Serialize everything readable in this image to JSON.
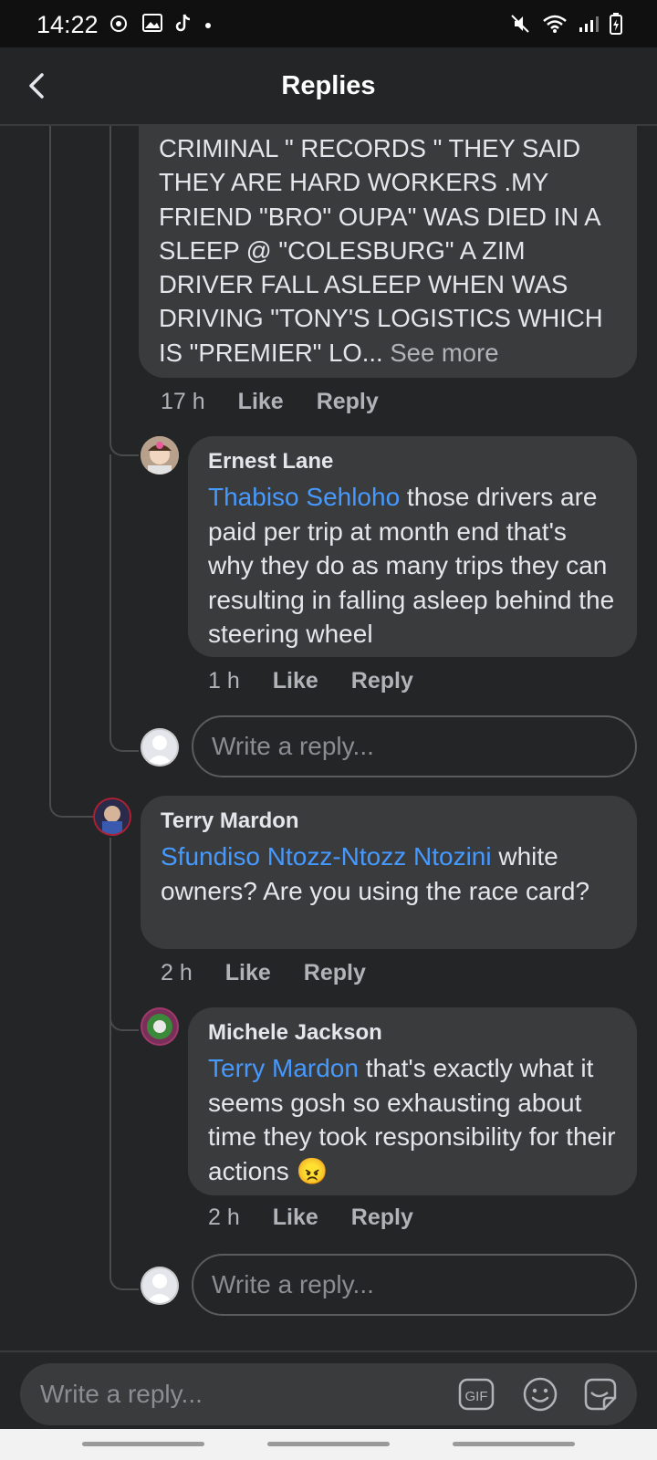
{
  "status_bar": {
    "time": "14:22"
  },
  "header": {
    "title": "Replies"
  },
  "comments": [
    {
      "partial_text": "CRIMINAL \" RECORDS \" THEY SAID THEY ARE HARD WORKERS .MY FRIEND \"BRO\" OUPA\" WAS DIED IN A SLEEP @ \"COLESBURG\" A ZIM DRIVER FALL ASLEEP WHEN WAS DRIVING \"TONY'S LOGISTICS WHICH IS \"PREMIER\" LO...",
      "see_more": "See more",
      "time": "17 h",
      "like": "Like",
      "reply": "Reply"
    },
    {
      "author": "Ernest Lane",
      "mention": "Thabiso Sehloho",
      "text": " those drivers are paid per trip at month end that's why they do as many trips they can resulting in falling asleep behind the steering wheel",
      "time": "1 h",
      "like": "Like",
      "reply": "Reply"
    },
    {
      "author": "Terry Mardon",
      "mention": "Sfundiso Ntozz-Ntozz Ntozini",
      "text": " white owners? Are you using the race card?",
      "time": "2 h",
      "like": "Like",
      "reply": "Reply"
    },
    {
      "author": "Michele Jackson",
      "mention": "Terry Mardon",
      "text": " that's exactly what it seems gosh so exhausting about time they took responsibility for their actions",
      "emoji": "😠",
      "time": "2 h",
      "like": "Like",
      "reply": "Reply"
    }
  ],
  "reply_inputs": [
    {
      "placeholder": "Write a reply..."
    },
    {
      "placeholder": "Write a reply..."
    }
  ],
  "composer": {
    "placeholder": "Write a reply...",
    "gif_label": "GIF"
  }
}
